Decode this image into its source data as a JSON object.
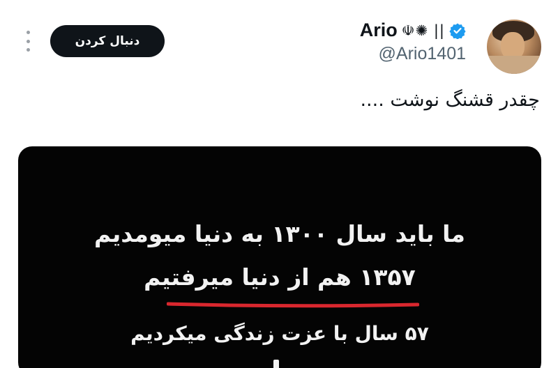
{
  "profile": {
    "display_name": "Ario",
    "name_symbols": "☫✺ ||",
    "handle": "@Ario1401",
    "verified_icon": "verified-badge-icon",
    "verified_color": "#1d9bf0"
  },
  "actions": {
    "follow_label": "دنبال کردن",
    "more_icon": "more-vertical-icon"
  },
  "tweet": {
    "text": "چقدر قشنگ نوشت ...."
  },
  "media": {
    "lines": [
      "ما باید سال ۱۳۰۰ به دنیا میومدیم",
      "۱۳۵۷ هم از دنیا میرفتیم",
      "۵۷ سال با عزت زندگی میکردیم"
    ],
    "underline_color": "#d9272e"
  }
}
